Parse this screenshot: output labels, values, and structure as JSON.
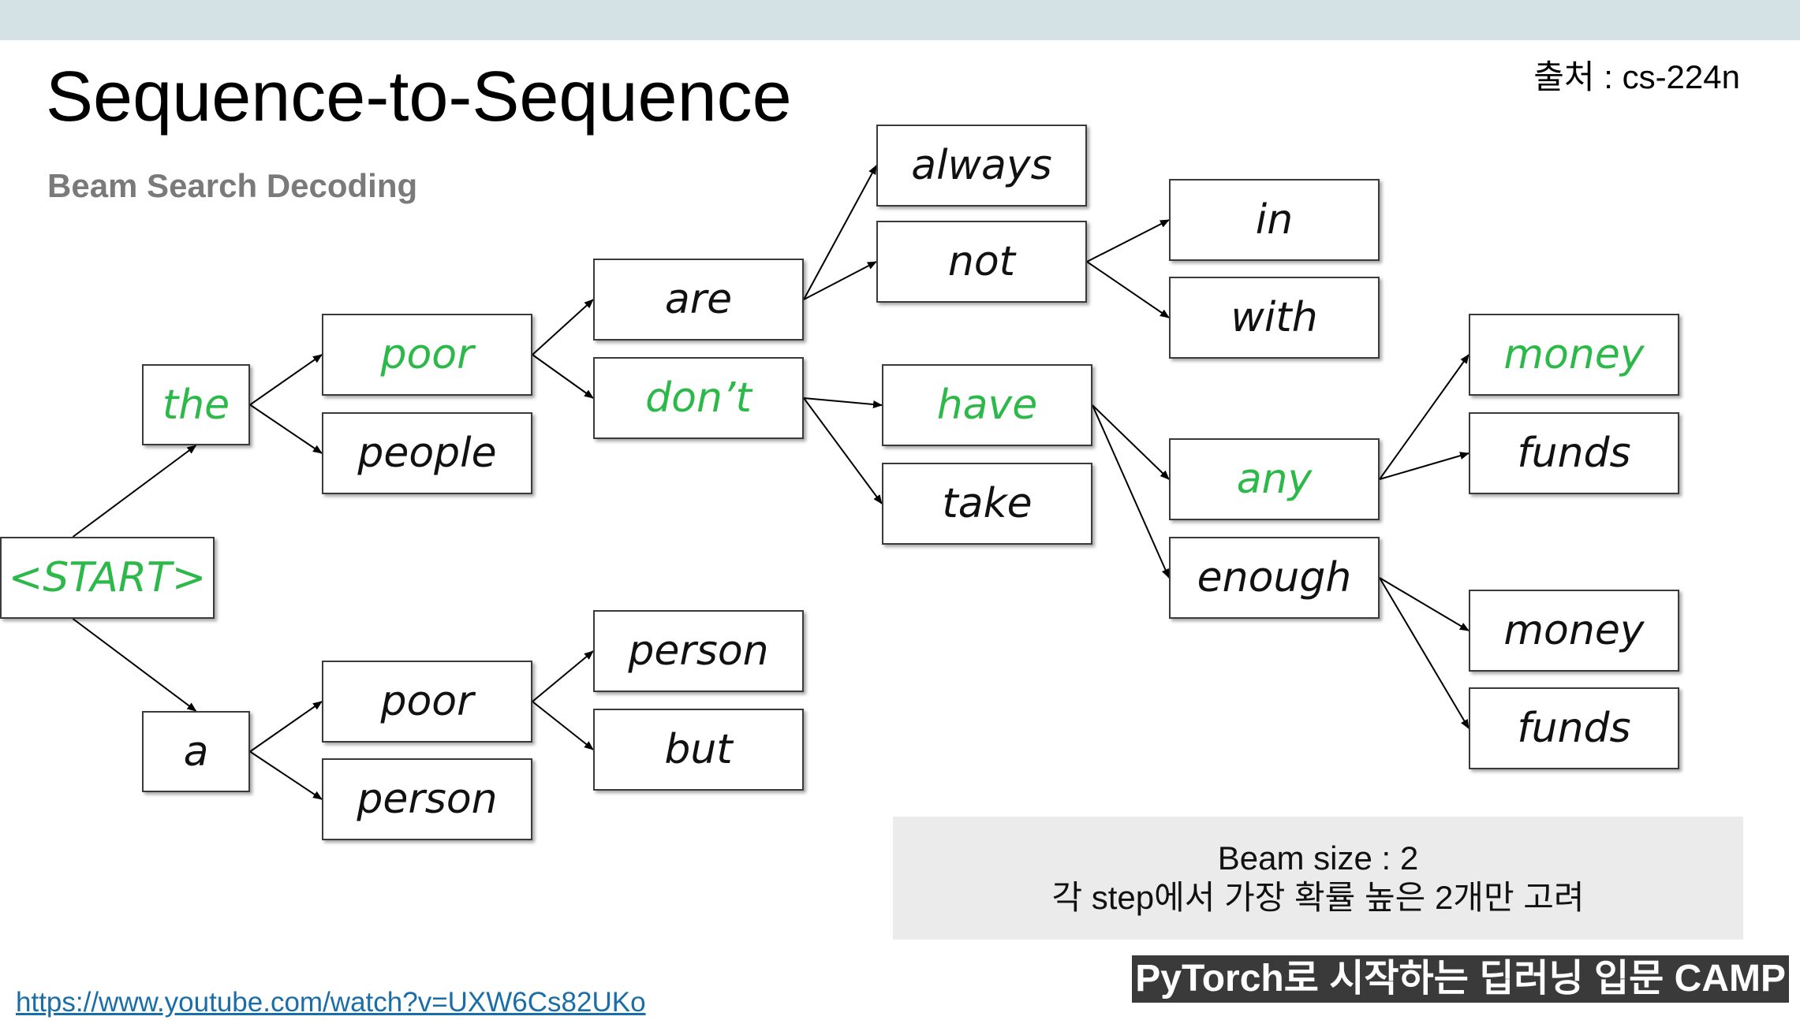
{
  "header": {
    "title": "Sequence-to-Sequence",
    "subtitle": "Beam Search Decoding",
    "source": "출처 : cs-224n"
  },
  "diagram": {
    "nodes": {
      "start": "<START>",
      "the": "the",
      "a": "a",
      "poor_1": "poor",
      "people": "people",
      "poor_2": "poor",
      "person_1": "person",
      "are": "are",
      "dont": "don’t",
      "person_2": "person",
      "but": "but",
      "always": "always",
      "not": "not",
      "have": "have",
      "take": "take",
      "in": "in",
      "with": "with",
      "any": "any",
      "enough": "enough",
      "money_1": "money",
      "funds_1": "funds",
      "money_2": "money",
      "funds_2": "funds"
    },
    "beam_path": [
      "start",
      "the",
      "poor_1",
      "dont",
      "have",
      "any",
      "money_1"
    ],
    "highlight_color": "#2db84a"
  },
  "note": {
    "line1": "Beam size : 2",
    "line2": "각 step에서 가장 확률 높은 2개만 고려"
  },
  "footer": {
    "camp": "PyTorch로 시작하는 딥러닝 입문 CAMP",
    "link": "https://www.youtube.com/watch?v=UXW6Cs82UKo"
  }
}
